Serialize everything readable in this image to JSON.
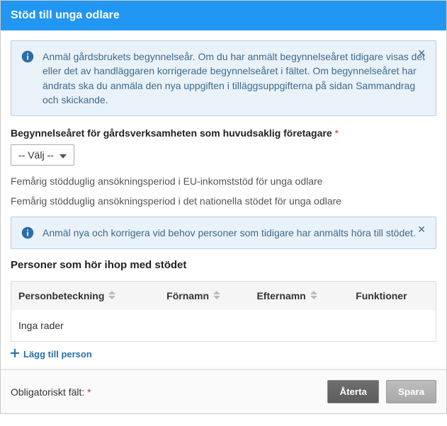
{
  "title": "Stöd till unga odlare",
  "info1": "Anmäl gårdsbrukets begynnelseår. Om du har anmält begynnelseåret tidigare visas det eller det av handläggaren korrigerade begynnelseåret i fältet. Om begynnelseåret har ändrats ska du anmäla den nya uppgiften i tilläggsuppgifterna på sidan Sammandrag och skickande.",
  "yearField": {
    "label": "Begynnelseåret för gårdsverksamheten som huvudsaklig företagare",
    "required": "*",
    "selected": "-- Välj --"
  },
  "period1": "Femårig stödduglig ansökningsperiod i EU-inkomststöd för unga odlare",
  "period2": "Femårig stödduglig ansökningsperiod i det nationella stödet för unga odlare",
  "info2": "Anmäl nya och korrigera vid behov personer som tidigare har anmälts höra till stödet.",
  "personsTitle": "Personer som hör ihop med stödet",
  "table": {
    "col1": "Personbeteckning",
    "col2": "Förnamn",
    "col3": "Efternamn",
    "col4": "Funktioner",
    "empty": "Inga rader"
  },
  "addPerson": "Lägg till person",
  "footer": {
    "note": "Obligatoriskt fält:",
    "req": "*",
    "revert": "Återta",
    "save": "Spara"
  }
}
